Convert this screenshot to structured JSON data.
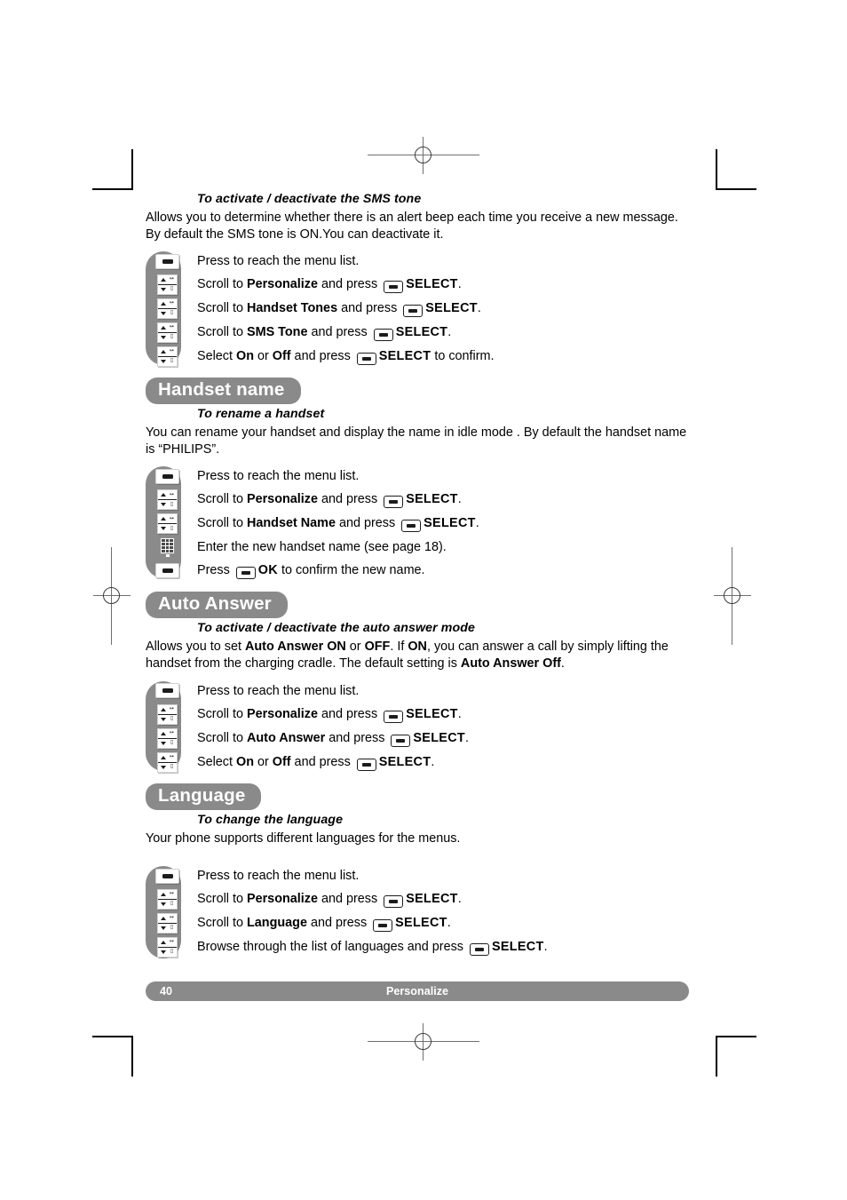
{
  "document": {
    "page_number": "40",
    "footer_section": "Personalize",
    "colors": {
      "gray": "#8a8a8a",
      "text": "#000000",
      "footer_text": "#ffffff"
    }
  },
  "sections": [
    {
      "heading": null,
      "subhead": "To activate / deactivate the SMS tone",
      "paragraph_parts": [
        "Allows you to determine whether there is an alert beep each time you receive a new message. By default the SMS tone is ON.You can deactivate it."
      ],
      "steps": [
        {
          "icon": "softkey-icon",
          "pre": "Press to reach the menu list.",
          "bold": "",
          "mid": "",
          "button": false,
          "sel": "",
          "post": ""
        },
        {
          "icon": "scroll-key-icon",
          "pre": "Scroll to ",
          "bold": "Personalize",
          "mid": " and press ",
          "button": true,
          "sel": "SELECT",
          "post": "."
        },
        {
          "icon": "scroll-key-icon",
          "pre": "Scroll to ",
          "bold": "Handset Tones",
          "mid": " and press ",
          "button": true,
          "sel": "SELECT",
          "post": "."
        },
        {
          "icon": "scroll-key-icon",
          "pre": "Scroll to ",
          "bold": "SMS Tone",
          "mid": " and press ",
          "button": true,
          "sel": "SELECT",
          "post": "."
        },
        {
          "icon": "scroll-key-icon",
          "pre": "Select ",
          "bold": "On",
          "mid": " or ",
          "bold2": "Off",
          "mid2": " and press ",
          "button": true,
          "sel": "SELECT",
          "post": " to confirm."
        }
      ]
    },
    {
      "heading": "Handset name",
      "subhead": "To rename a handset",
      "paragraph_parts": [
        "You can rename your handset and display the name in idle mode . By default the handset name is “PHILIPS”."
      ],
      "steps": [
        {
          "icon": "softkey-icon",
          "pre": "Press to reach the menu list.",
          "bold": "",
          "mid": "",
          "button": false,
          "sel": "",
          "post": ""
        },
        {
          "icon": "scroll-key-icon",
          "pre": "Scroll to ",
          "bold": "Personalize",
          "mid": " and press ",
          "button": true,
          "sel": "SELECT",
          "post": "."
        },
        {
          "icon": "scroll-key-icon",
          "pre": "Scroll to ",
          "bold": "Handset Name",
          "mid": " and press ",
          "button": true,
          "sel": "SELECT",
          "post": "."
        },
        {
          "icon": "keypad-icon",
          "pre": "Enter the new handset name (see page 18).",
          "bold": "",
          "mid": "",
          "button": false,
          "sel": "",
          "post": ""
        },
        {
          "icon": "softkey-icon",
          "pre": "Press ",
          "bold": "",
          "mid": "",
          "button": true,
          "sel": "OK",
          "post": " to confirm the new name."
        }
      ]
    },
    {
      "heading": "Auto Answer",
      "subhead": "To activate / deactivate the auto answer mode",
      "paragraph_parts": [
        "Allows you to set Auto Answer ON or OFF. If ON, you can answer a call by simply lifting the handset from the charging cradle. The default setting is Auto Answer Off."
      ],
      "steps": [
        {
          "icon": "softkey-icon",
          "pre": "Press to reach the menu list.",
          "bold": "",
          "mid": "",
          "button": false,
          "sel": "",
          "post": ""
        },
        {
          "icon": "scroll-key-icon",
          "pre": "Scroll to ",
          "bold": "Personalize",
          "mid": " and press ",
          "button": true,
          "sel": "SELECT",
          "post": "."
        },
        {
          "icon": "scroll-key-icon",
          "pre": "Scroll to ",
          "bold": "Auto Answer",
          "mid": " and press ",
          "button": true,
          "sel": "SELECT",
          "post": "."
        },
        {
          "icon": "scroll-key-icon",
          "pre": "Select ",
          "bold": "On",
          "mid": " or ",
          "bold2": "Off",
          "mid2": " and press ",
          "button": true,
          "sel": "SELECT",
          "post": "."
        }
      ]
    },
    {
      "heading": "Language",
      "subhead": "To change the language",
      "paragraph_parts": [
        "Your phone supports different languages for the menus."
      ],
      "steps": [
        {
          "icon": "softkey-icon",
          "pre": "Press to reach the menu list.",
          "bold": "",
          "mid": "",
          "button": false,
          "sel": "",
          "post": ""
        },
        {
          "icon": "scroll-key-icon",
          "pre": "Scroll to ",
          "bold": "Personalize",
          "mid": " and press ",
          "button": true,
          "sel": "SELECT",
          "post": "."
        },
        {
          "icon": "scroll-key-icon",
          "pre": "Scroll to ",
          "bold": "Language",
          "mid": " and press ",
          "button": true,
          "sel": "SELECT",
          "post": "."
        },
        {
          "icon": "scroll-key-icon",
          "pre": "Browse through the list of languages and press ",
          "bold": "",
          "mid": "",
          "button": true,
          "sel": "SELECT",
          "post": "."
        }
      ]
    }
  ],
  "text": {
    "s1_sub": "To activate / deactivate the SMS tone",
    "s1_p1a": "Allows you to determine whether there is an alert beep each time you receive a new message.",
    "s1_p1b": "By default the SMS tone is ON.You can deactivate it.",
    "s1_r1": "Press to reach the menu list.",
    "s1_r2a": "Scroll to ",
    "s1_r2b": "Personalize",
    "s1_r2c": " and press ",
    "s1_r2d": "SELECT",
    "s1_r2e": ".",
    "s1_r3a": "Scroll to ",
    "s1_r3b": "Handset Tones",
    "s1_r3c": " and press ",
    "s1_r3d": "SELECT",
    "s1_r3e": ".",
    "s1_r4a": "Scroll to ",
    "s1_r4b": "SMS Tone",
    "s1_r4c": " and press ",
    "s1_r4d": "SELECT",
    "s1_r4e": ".",
    "s1_r5a": "Select ",
    "s1_r5b": "On",
    "s1_r5c": " or ",
    "s1_r5d": "Off",
    "s1_r5e": " and press ",
    "s1_r5f": "SELECT",
    "s1_r5g": " to confirm.",
    "s2_head": "Handset name",
    "s2_sub": "To rename a handset",
    "s2_p1a": "You can rename your handset and display the name in idle mode . By default the handset name",
    "s2_p1b": "is “PHILIPS”.",
    "s2_r1": "Press to reach the menu list.",
    "s2_r2a": "Scroll to ",
    "s2_r2b": "Personalize",
    "s2_r2c": " and press ",
    "s2_r2d": "SELECT",
    "s2_r2e": ".",
    "s2_r3a": "Scroll to ",
    "s2_r3b": "Handset Name",
    "s2_r3c": " and press ",
    "s2_r3d": "SELECT",
    "s2_r3e": ".",
    "s2_r4": "Enter the new handset name (see page 18).",
    "s2_r5a": "Press ",
    "s2_r5b": "OK",
    "s2_r5c": " to confirm the new name.",
    "s3_head": "Auto Answer",
    "s3_sub": "To activate / deactivate the auto answer mode",
    "s3_p1a": "Allows you to set ",
    "s3_p1b": "Auto Answer ON",
    "s3_p1c": " or ",
    "s3_p1d": "OFF",
    "s3_p1e": ". If ",
    "s3_p1f": "ON",
    "s3_p1g": ", you can answer a call by simply lifting",
    "s3_p2a": "the handset from the charging cradle. The default setting is ",
    "s3_p2b": "Auto Answer Off",
    "s3_p2c": ".",
    "s3_r1": "Press to reach the menu list.",
    "s3_r2a": "Scroll to ",
    "s3_r2b": "Personalize",
    "s3_r2c": " and press ",
    "s3_r2d": "SELECT",
    "s3_r2e": ".",
    "s3_r3a": "Scroll to ",
    "s3_r3b": "Auto Answer",
    "s3_r3c": " and press ",
    "s3_r3d": "SELECT",
    "s3_r3e": ".",
    "s3_r4a": "Select ",
    "s3_r4b": "On",
    "s3_r4c": " or ",
    "s3_r4d": "Off",
    "s3_r4e": " and press ",
    "s3_r4f": "SELECT",
    "s3_r4g": ".",
    "s4_head": "Language",
    "s4_sub": "To change the language",
    "s4_p1": "Your phone supports different languages for the menus.",
    "s4_r1": "Press to reach the menu list.",
    "s4_r2a": "Scroll to ",
    "s4_r2b": "Personalize",
    "s4_r2c": " and press ",
    "s4_r2d": "SELECT",
    "s4_r2e": ".",
    "s4_r3a": "Scroll to ",
    "s4_r3b": "Language",
    "s4_r3c": " and press ",
    "s4_r3d": "SELECT",
    "s4_r3e": ".",
    "s4_r4a": "Browse through the list of languages and press ",
    "s4_r4b": "SELECT",
    "s4_r4c": "."
  }
}
